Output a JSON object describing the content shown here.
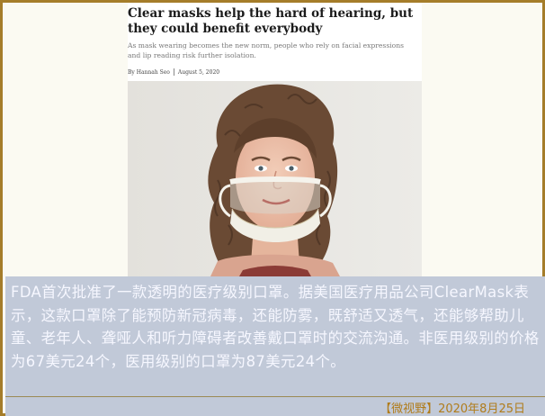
{
  "article": {
    "headline": "Clear masks help the hard of hearing, but they could benefit everybody",
    "subhead": "As mask wearing becomes the new norm, people who rely on facial expressions and lip reading risk further isolation.",
    "author": "By Hannah Seo",
    "date": "August 5, 2020"
  },
  "caption": {
    "text": "FDA首次批准了一款透明的医疗级别口罩。据美国医疗用品公司ClearMask表示，这款口罩除了能预防新冠病毒，还能防雾，既舒适又透气，还能够帮助儿童、老年人、聋哑人和听力障碍者改善戴口罩时的交流沟通。非医用级别的价格为67美元24个，医用级别的口罩为87美元24个。"
  },
  "footer": {
    "source": "【微视野】2020年8月25日"
  },
  "colors": {
    "frame_border": "#a57d2a",
    "caption_bg": "#c1c9d8",
    "caption_text": "#f6f7ff",
    "source_text": "#b07c1b"
  }
}
